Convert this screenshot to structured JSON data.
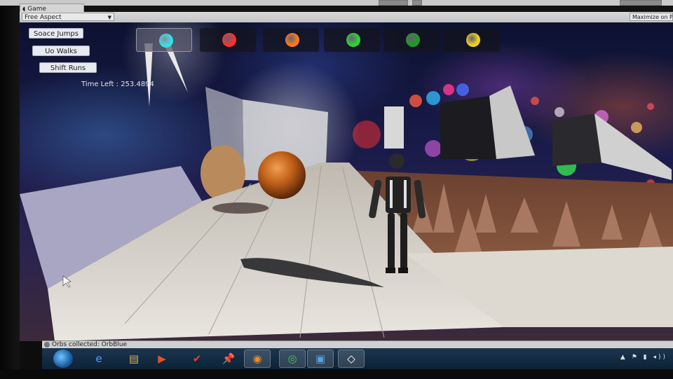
{
  "editor": {
    "tab_title": "Game",
    "aspect_label": "Free Aspect",
    "maximize_label": "Maximize on Pla"
  },
  "hud": {
    "buttons": [
      "Soace Jumps",
      "Uo Walks",
      "Shift Runs"
    ],
    "time_left": "Time Left : 253.4894"
  },
  "orbs": [
    {
      "color": "#33e0e6",
      "selected": true
    },
    {
      "color": "#ff3030",
      "selected": false
    },
    {
      "color": "#ff7a1a",
      "selected": false
    },
    {
      "color": "#2fd23a",
      "selected": false
    },
    {
      "color": "#1f9a2a",
      "selected": false
    },
    {
      "color": "#f0d020",
      "selected": false
    }
  ],
  "status": {
    "message": "Orbs collected: OrbBlue"
  },
  "taskbar": {
    "items": [
      {
        "name": "ie-icon",
        "glyph": "e"
      },
      {
        "name": "file-explorer-icon",
        "glyph": "▤"
      },
      {
        "name": "media-player-icon",
        "glyph": "▶"
      },
      {
        "name": "todoist-icon",
        "glyph": "✔"
      },
      {
        "name": "pin-icon",
        "glyph": "📌"
      },
      {
        "name": "firefox-icon",
        "glyph": "◉"
      },
      {
        "name": "chrome-icon",
        "glyph": "◎"
      },
      {
        "name": "monitor-app-icon",
        "glyph": "▣"
      },
      {
        "name": "unity-icon",
        "glyph": "◇"
      }
    ]
  }
}
